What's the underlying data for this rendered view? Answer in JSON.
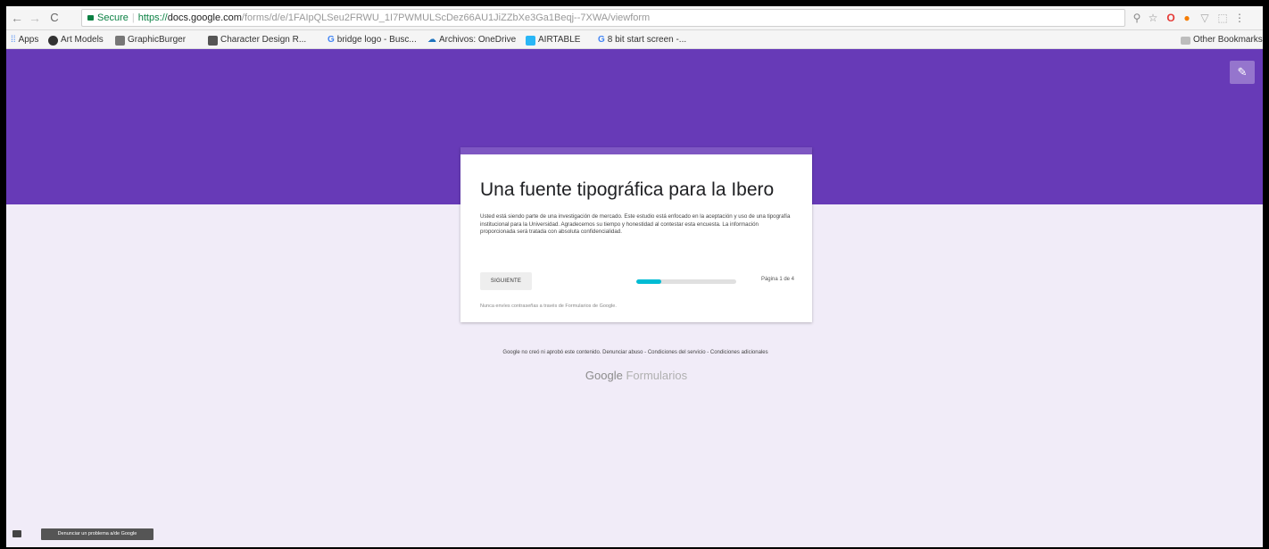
{
  "browser": {
    "nav": {
      "back": "←",
      "forward": "→",
      "reload": "C"
    },
    "omnibox": {
      "secure_label": "Secure",
      "protocol": "https://",
      "host": "docs.google.com",
      "path": "/forms/d/e/1FAIpQLSeu2FRWU_1I7PWMULScDez66AU1JiZZbXe3Ga1Beqj--7XWA/viewform"
    },
    "extensions": {
      "zoom": "⚲",
      "star": "☆",
      "opera": "O",
      "fox": "●",
      "shield": "▽",
      "ext": "⬚",
      "menu": "⋮"
    },
    "colors": {
      "opera": "#e53935",
      "fox": "#f57c00"
    }
  },
  "bookmarks": {
    "apps": "Apps",
    "items": [
      {
        "label": "Art Models",
        "color": "#333333"
      },
      {
        "label": "GraphicBurger",
        "color": "#777777"
      },
      {
        "label": "Character Design R...",
        "color": "#555555"
      },
      {
        "label": "bridge logo - Busc...",
        "color": "#4285f4"
      },
      {
        "label": "Archivos: OneDrive",
        "color": "#1e73be"
      },
      {
        "label": "AIRTABLE",
        "color": "#29b6f6"
      },
      {
        "label": "8 bit start screen -...",
        "color": "#4285f4"
      }
    ],
    "other": "Other Bookmarks"
  },
  "form": {
    "theme_color": "#673ab7",
    "background_color": "#f1ecf8",
    "edit_icon": "✎",
    "title": "Una fuente tipográfica para la Ibero",
    "description": "Usted está siendo parte de una investigación de mercado. Este estudio está enfocado en la aceptación y uso de una tipografía institucional para la Universidad. Agradecemos su tiempo y honestidad al contestar esta encuesta. La información proporcionada será tratada con absoluta confidencialidad.",
    "next_label": "SIGUIENTE",
    "progress": 0.25,
    "page_indicator": "Página 1 de 4",
    "footnote": "Nunca envíes contraseñas a través de Formularios de Google.",
    "footer_links": "Google no creó ni aprobó este contenido. Denunciar abuso - Condiciones del servicio - Condiciones adicionales",
    "logo_google": "Google",
    "logo_formularios": "Formularios",
    "report_label": "Denunciar un problema a/de Google"
  }
}
